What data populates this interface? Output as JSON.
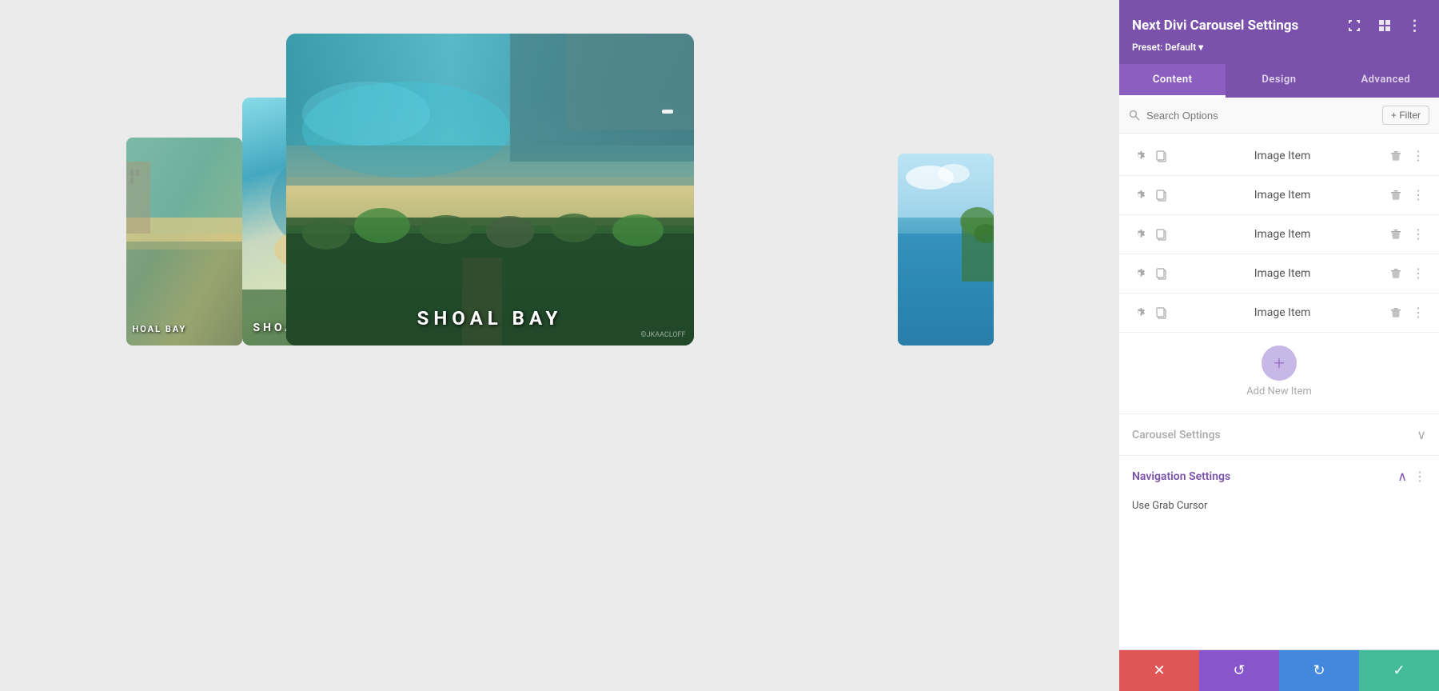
{
  "panel": {
    "title": "Next Divi Carousel Settings",
    "preset_label": "Preset: Default",
    "preset_arrow": "▾",
    "tabs": [
      {
        "label": "Content",
        "active": true
      },
      {
        "label": "Design",
        "active": false
      },
      {
        "label": "Advanced",
        "active": false
      }
    ],
    "search_placeholder": "Search Options",
    "filter_label": "+ Filter",
    "items": [
      {
        "label": "Image Item"
      },
      {
        "label": "Image Item"
      },
      {
        "label": "Image Item"
      },
      {
        "label": "Image Item"
      },
      {
        "label": "Image Item"
      }
    ],
    "add_new_label": "Add New Item",
    "carousel_settings_label": "Carousel Settings",
    "navigation_settings_label": "Navigation Settings",
    "use_grab_cursor_label": "Use Grab Cursor",
    "watermark": "©JKAACLOFF"
  },
  "carousel": {
    "label": "SHOAL BAY",
    "label_left": "HOAL BAY",
    "label_left_second": "SHOAL BAY"
  },
  "bottom_bar": {
    "cancel_icon": "✕",
    "undo_icon": "↺",
    "redo_icon": "↻",
    "save_icon": "✓"
  }
}
